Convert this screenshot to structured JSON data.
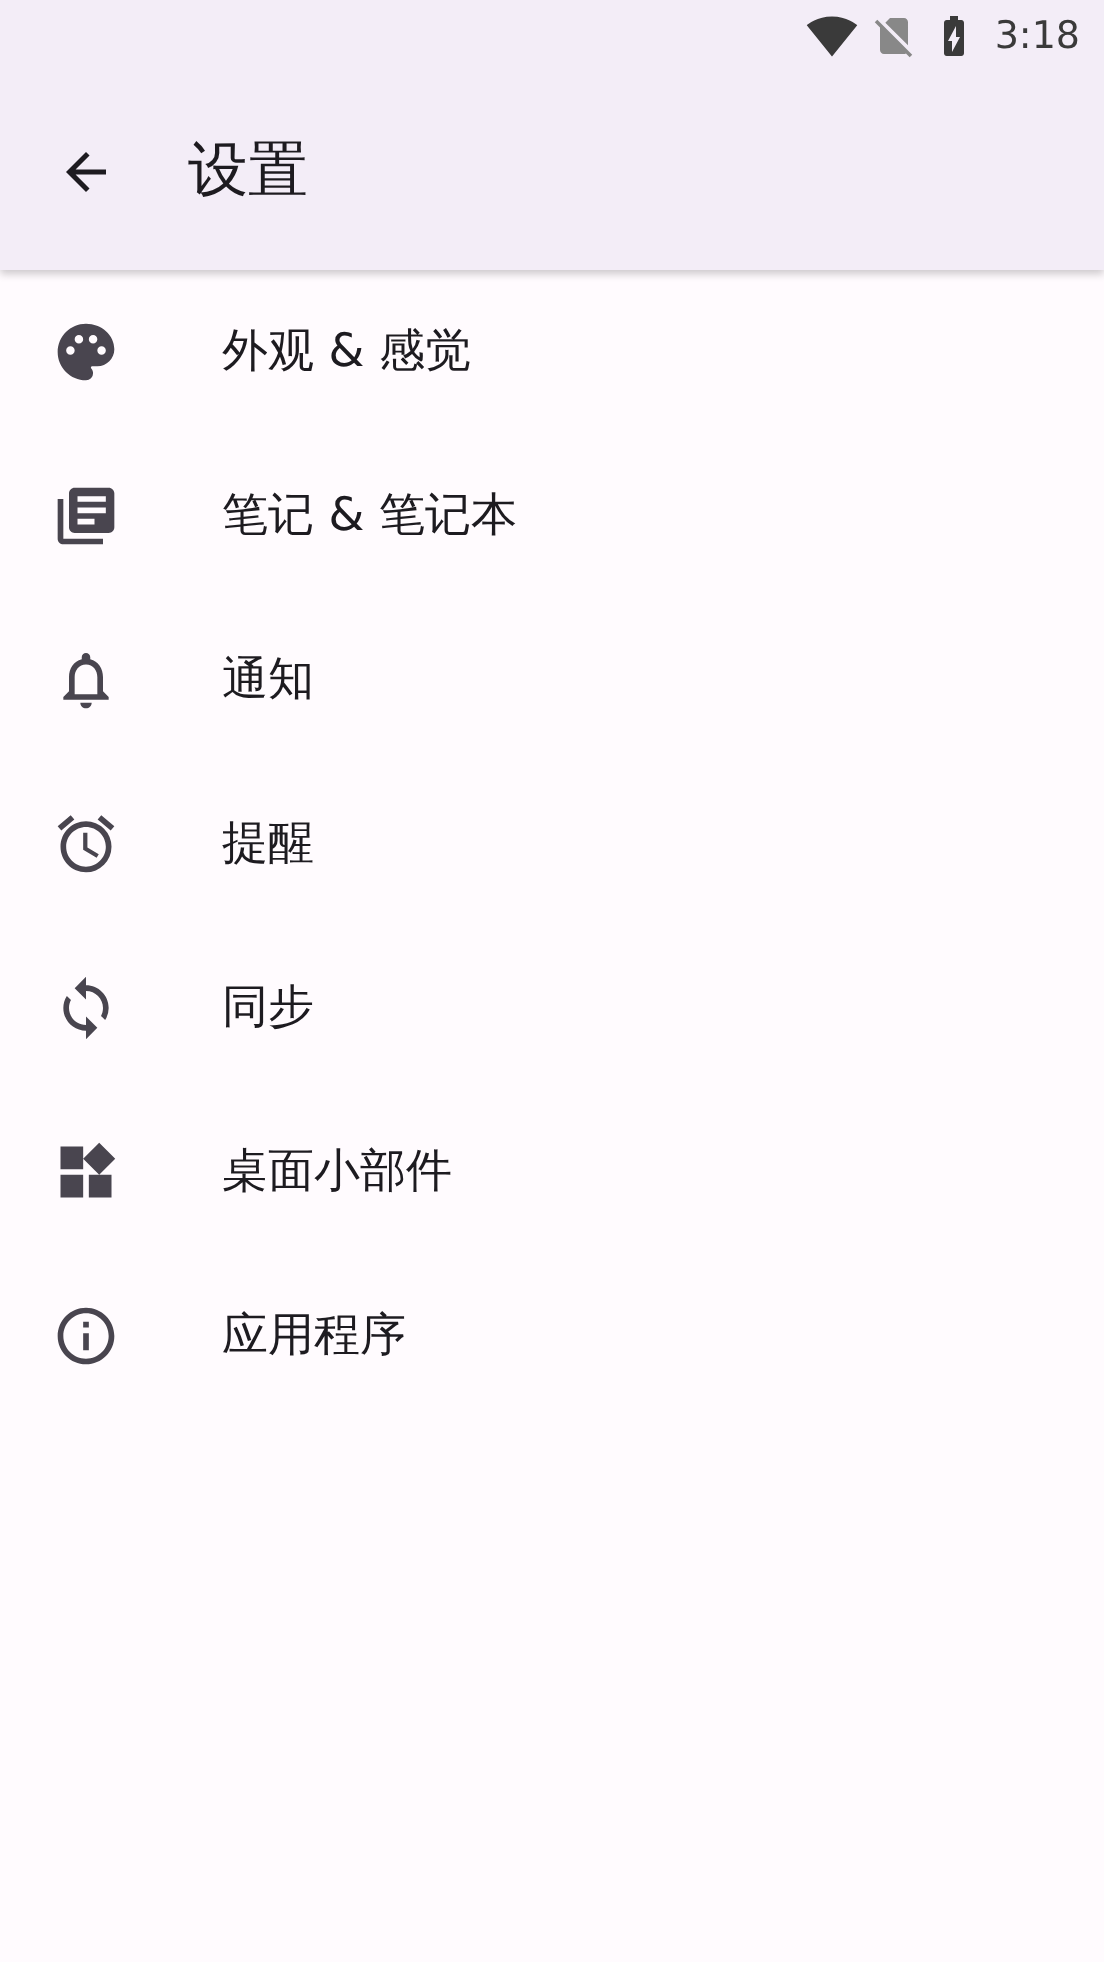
{
  "status_bar": {
    "time": "3:18"
  },
  "app_bar": {
    "title": "设置"
  },
  "items": [
    {
      "kind": "palette",
      "label": "外观 & 感觉"
    },
    {
      "kind": "notes",
      "label": "笔记 & 笔记本"
    },
    {
      "kind": "bell",
      "label": "通知"
    },
    {
      "kind": "alarm",
      "label": "提醒"
    },
    {
      "kind": "sync",
      "label": "同步"
    },
    {
      "kind": "widgets",
      "label": "桌面小部件"
    },
    {
      "kind": "info",
      "label": "应用程序"
    }
  ]
}
